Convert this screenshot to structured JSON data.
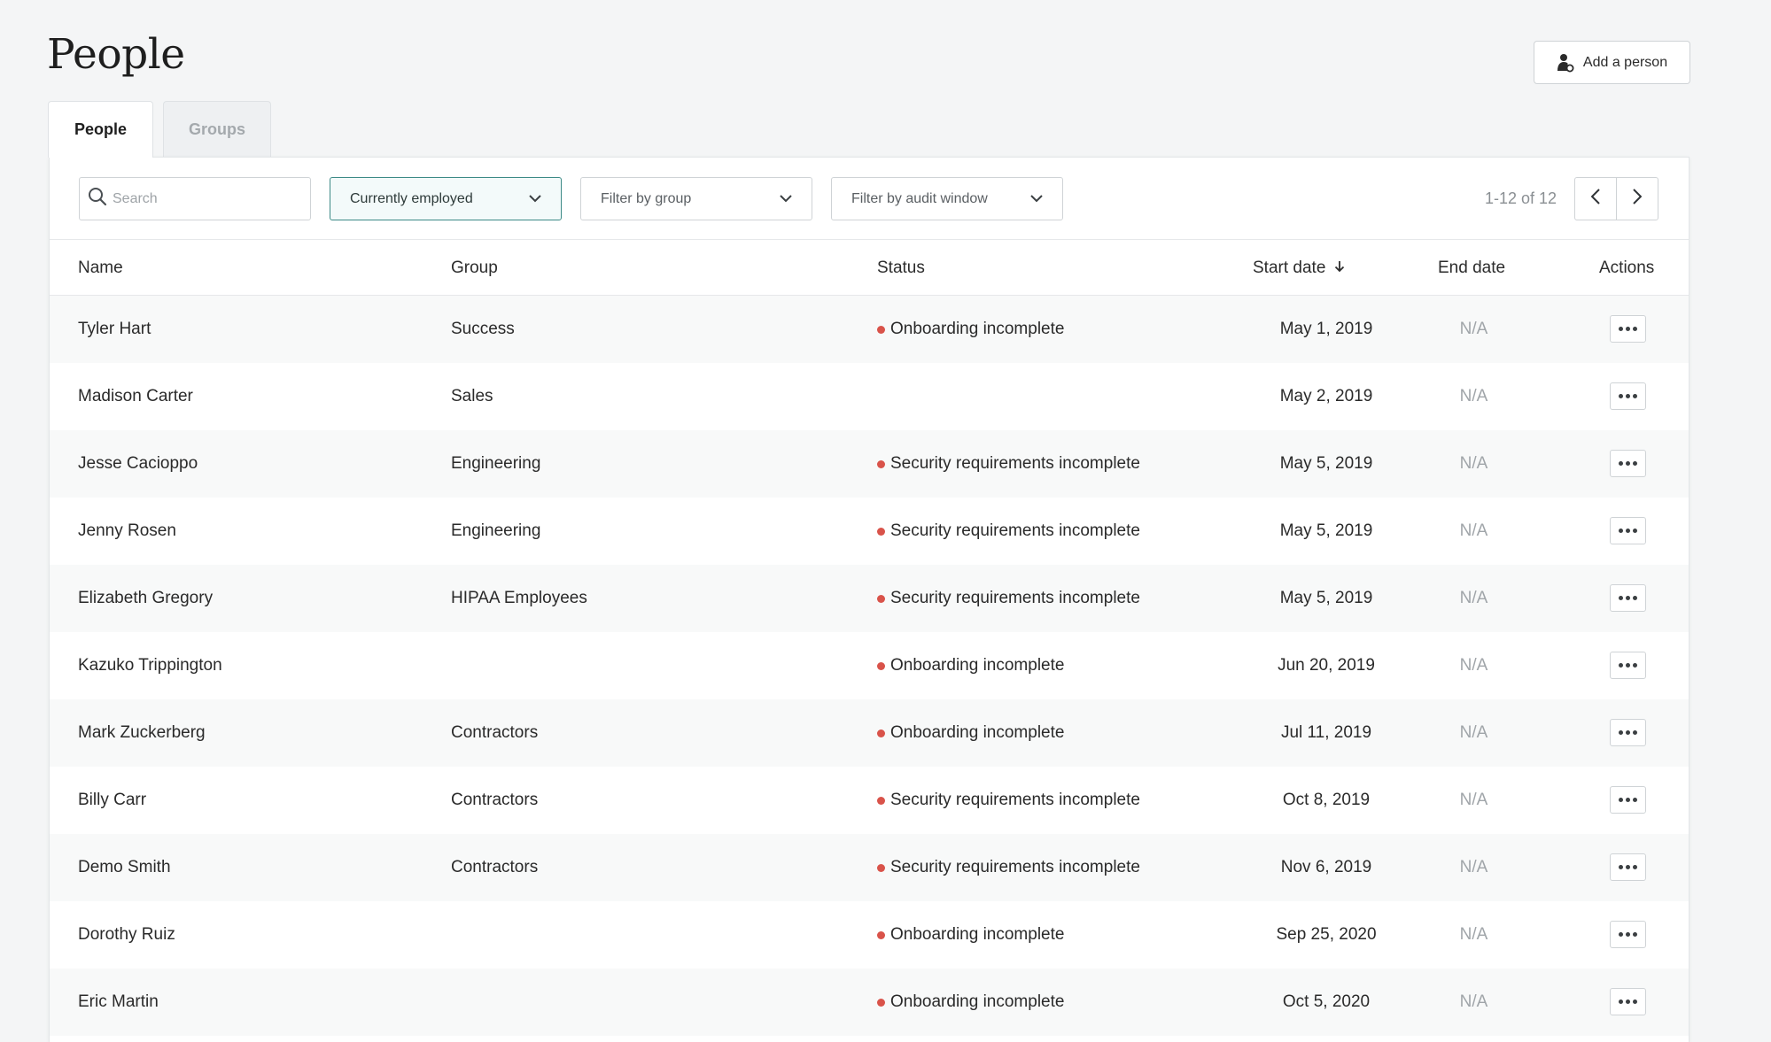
{
  "header": {
    "title": "People",
    "add_button_label": "Add a person"
  },
  "tabs": [
    {
      "label": "People",
      "active": true
    },
    {
      "label": "Groups",
      "active": false
    }
  ],
  "toolbar": {
    "search_placeholder": "Search",
    "filters": [
      {
        "label": "Currently employed",
        "selected": true
      },
      {
        "label": "Filter by group",
        "selected": false
      },
      {
        "label": "Filter by audit window",
        "selected": false
      }
    ],
    "pagination": "1-12 of 12"
  },
  "table": {
    "columns": {
      "name": "Name",
      "group": "Group",
      "status": "Status",
      "start_date": "Start date",
      "end_date": "End date",
      "actions": "Actions"
    },
    "sort": {
      "column": "start_date",
      "direction": "descending-arrow"
    },
    "status_dot_color": "#d9534a",
    "rows": [
      {
        "name": "Tyler Hart",
        "group": "Success",
        "status": "Onboarding incomplete",
        "start": "May 1, 2019",
        "end": "N/A"
      },
      {
        "name": "Madison Carter",
        "group": "Sales",
        "status": "",
        "start": "May 2, 2019",
        "end": "N/A"
      },
      {
        "name": "Jesse Cacioppo",
        "group": "Engineering",
        "status": "Security requirements incomplete",
        "start": "May 5, 2019",
        "end": "N/A"
      },
      {
        "name": "Jenny Rosen",
        "group": "Engineering",
        "status": "Security requirements incomplete",
        "start": "May 5, 2019",
        "end": "N/A"
      },
      {
        "name": "Elizabeth Gregory",
        "group": "HIPAA Employees",
        "status": "Security requirements incomplete",
        "start": "May 5, 2019",
        "end": "N/A"
      },
      {
        "name": "Kazuko Trippington",
        "group": "",
        "status": "Onboarding incomplete",
        "start": "Jun 20, 2019",
        "end": "N/A"
      },
      {
        "name": "Mark Zuckerberg",
        "group": "Contractors",
        "status": "Onboarding incomplete",
        "start": "Jul 11, 2019",
        "end": "N/A"
      },
      {
        "name": "Billy Carr",
        "group": "Contractors",
        "status": "Security requirements incomplete",
        "start": "Oct 8, 2019",
        "end": "N/A"
      },
      {
        "name": "Demo Smith",
        "group": "Contractors",
        "status": "Security requirements incomplete",
        "start": "Nov 6, 2019",
        "end": "N/A"
      },
      {
        "name": "Dorothy Ruiz",
        "group": "",
        "status": "Onboarding incomplete",
        "start": "Sep 25, 2020",
        "end": "N/A"
      },
      {
        "name": "Eric Martin",
        "group": "",
        "status": "Onboarding incomplete",
        "start": "Oct 5, 2020",
        "end": "N/A"
      }
    ]
  }
}
